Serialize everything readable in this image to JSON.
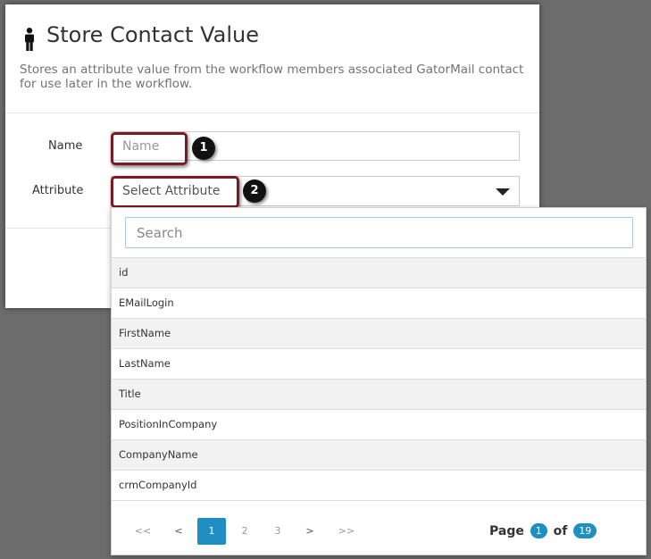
{
  "dialog": {
    "title": "Store Contact Value",
    "description": "Stores an attribute value from the workflow members associated GatorMail contact for use later in the workflow.",
    "name_label": "Name",
    "name_placeholder": "Name",
    "attribute_label": "Attribute",
    "attribute_value": "Select Attribute"
  },
  "callouts": [
    "1",
    "2"
  ],
  "dropdown": {
    "search_placeholder": "Search",
    "options": [
      "id",
      "EMailLogin",
      "FirstName",
      "LastName",
      "Title",
      "PositionInCompany",
      "CompanyName",
      "crmCompanyId"
    ],
    "pager": {
      "first": "<<",
      "prev": "<",
      "pages": [
        "1",
        "2",
        "3"
      ],
      "next": ">",
      "last": ">>",
      "page_word": "Page",
      "current": "1",
      "of_word": "of",
      "total": "19"
    }
  },
  "colors": {
    "accent": "#1f8ec0",
    "callout_border": "#7a1a22",
    "backdrop": "#6c6c6c"
  },
  "icons": {
    "title_icon": "person-icon",
    "select_caret": "caret-down-icon"
  }
}
